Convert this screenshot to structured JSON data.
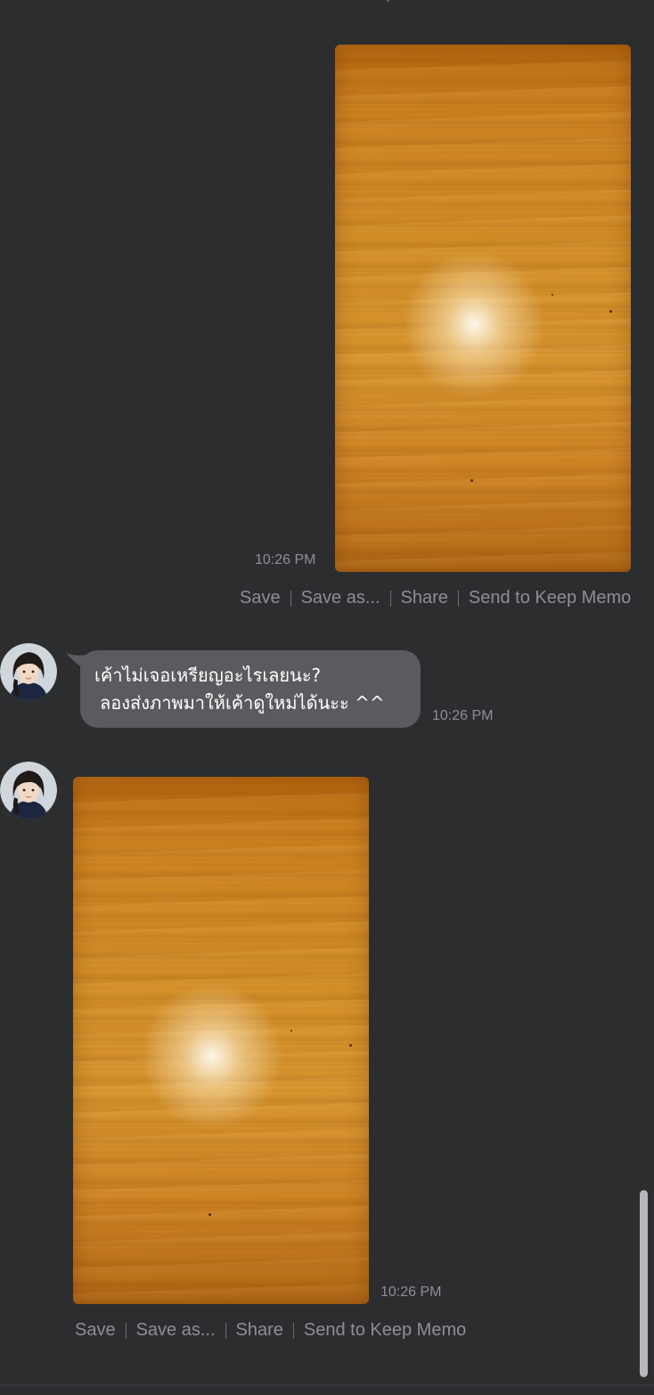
{
  "messages": [
    {
      "sender": "me",
      "type": "image",
      "time": "10:26 PM",
      "actions": [
        "Save",
        "Save as...",
        "Share",
        "Send to Keep Memo"
      ]
    },
    {
      "sender": "contact",
      "type": "text",
      "lines": [
        "เค้าไม่เจอเหรียญอะไรเลยนะ?",
        "ลองส่งภาพมาให้เค้าดูใหม่ได้นะะ ^^"
      ],
      "time": "10:26 PM",
      "avatar_icon": "user-avatar-icon"
    },
    {
      "sender": "contact",
      "type": "image",
      "time": "10:26 PM",
      "actions": [
        "Save",
        "Save as...",
        "Share",
        "Send to Keep Memo"
      ],
      "avatar_icon": "user-avatar-icon"
    }
  ],
  "colors": {
    "background": "#2c2d2f",
    "bubble": "#5a5b5e",
    "meta_text": "#8d8f94",
    "message_text": "#ffffff"
  }
}
